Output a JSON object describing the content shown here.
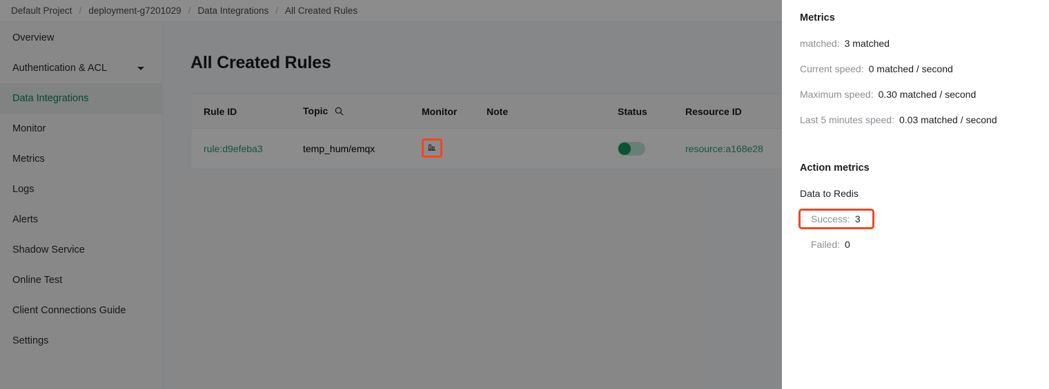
{
  "breadcrumb": {
    "items": [
      "Default Project",
      "deployment-g7201029",
      "Data Integrations",
      "All Created Rules"
    ],
    "separator": "/"
  },
  "sidebar": {
    "items": [
      {
        "label": "Overview",
        "active": false,
        "has_caret": false
      },
      {
        "label": "Authentication & ACL",
        "active": false,
        "has_caret": true
      },
      {
        "label": "Data Integrations",
        "active": true,
        "has_caret": false
      },
      {
        "label": "Monitor",
        "active": false,
        "has_caret": false
      },
      {
        "label": "Metrics",
        "active": false,
        "has_caret": false
      },
      {
        "label": "Logs",
        "active": false,
        "has_caret": false
      },
      {
        "label": "Alerts",
        "active": false,
        "has_caret": false
      },
      {
        "label": "Shadow Service",
        "active": false,
        "has_caret": false
      },
      {
        "label": "Online Test",
        "active": false,
        "has_caret": false
      },
      {
        "label": "Client Connections Guide",
        "active": false,
        "has_caret": false
      },
      {
        "label": "Settings",
        "active": false,
        "has_caret": false
      }
    ]
  },
  "main": {
    "title": "All Created Rules",
    "table": {
      "headers": {
        "rule_id": "Rule ID",
        "topic": "Topic",
        "topic_icon": "search-icon",
        "monitor": "Monitor",
        "note": "Note",
        "status": "Status",
        "resource_id": "Resource ID"
      },
      "rows": [
        {
          "rule_id": "rule:d9efeba3",
          "topic": "temp_hum/emqx",
          "monitor_icon": "bar-chart-icon",
          "note": "",
          "status_on": true,
          "resource_id": "resource:a168e28"
        }
      ]
    }
  },
  "drawer": {
    "metrics_heading": "Metrics",
    "metrics": [
      {
        "label": "matched:",
        "value": "3 matched"
      },
      {
        "label": "Current speed:",
        "value": "0 matched / second"
      },
      {
        "label": "Maximum speed:",
        "value": "0.30 matched / second"
      },
      {
        "label": "Last 5 minutes speed:",
        "value": "0.03 matched / second"
      }
    ],
    "action_heading": "Action metrics",
    "action_name": "Data to Redis",
    "action_stats": [
      {
        "label": "Success:",
        "value": "3"
      },
      {
        "label": "Failed:",
        "value": "0"
      }
    ]
  },
  "colors": {
    "accent_green": "#1f9e6a",
    "sidebar_active": "#00865a",
    "toggle_on": "#12955f",
    "highlight": "#f4441e"
  }
}
